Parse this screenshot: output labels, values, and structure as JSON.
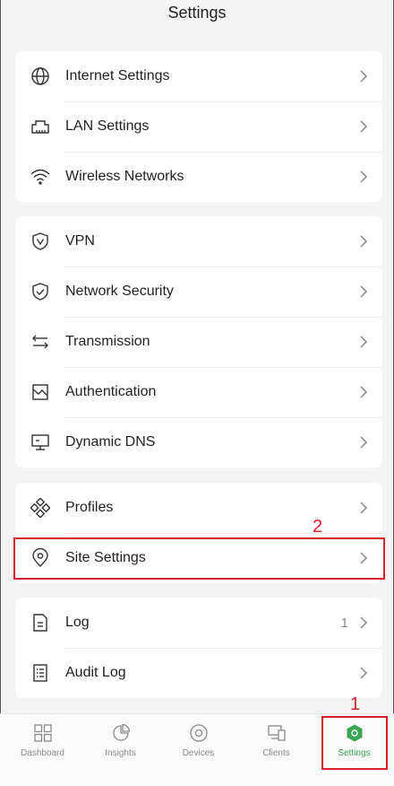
{
  "header": {
    "title": "Settings"
  },
  "groups": [
    {
      "items": [
        {
          "label": "Internet Settings",
          "icon": "globe-icon"
        },
        {
          "label": "LAN Settings",
          "icon": "lan-port-icon"
        },
        {
          "label": "Wireless Networks",
          "icon": "wifi-icon"
        }
      ]
    },
    {
      "items": [
        {
          "label": "VPN",
          "icon": "shield-v-icon"
        },
        {
          "label": "Network Security",
          "icon": "shield-check-icon"
        },
        {
          "label": "Transmission",
          "icon": "arrows-exchange-icon"
        },
        {
          "label": "Authentication",
          "icon": "authentication-icon"
        },
        {
          "label": "Dynamic DNS",
          "icon": "monitor-icon"
        }
      ]
    },
    {
      "items": [
        {
          "label": "Profiles",
          "icon": "diamonds-icon"
        },
        {
          "label": "Site Settings",
          "icon": "location-pin-icon"
        }
      ]
    },
    {
      "items": [
        {
          "label": "Log",
          "icon": "document-icon",
          "count": "1"
        },
        {
          "label": "Audit Log",
          "icon": "list-document-icon"
        }
      ]
    }
  ],
  "annotations": {
    "tab_marker": "1",
    "row_marker": "2",
    "color": "#d3232b"
  },
  "tabbar": {
    "active_color": "#3aa655",
    "tabs": [
      {
        "label": "Dashboard",
        "icon": "dashboard-icon"
      },
      {
        "label": "Insights",
        "icon": "pie-chart-icon"
      },
      {
        "label": "Devices",
        "icon": "device-circle-icon"
      },
      {
        "label": "Clients",
        "icon": "clients-icon"
      },
      {
        "label": "Settings",
        "icon": "settings-hexagon-icon",
        "active": true
      }
    ]
  }
}
